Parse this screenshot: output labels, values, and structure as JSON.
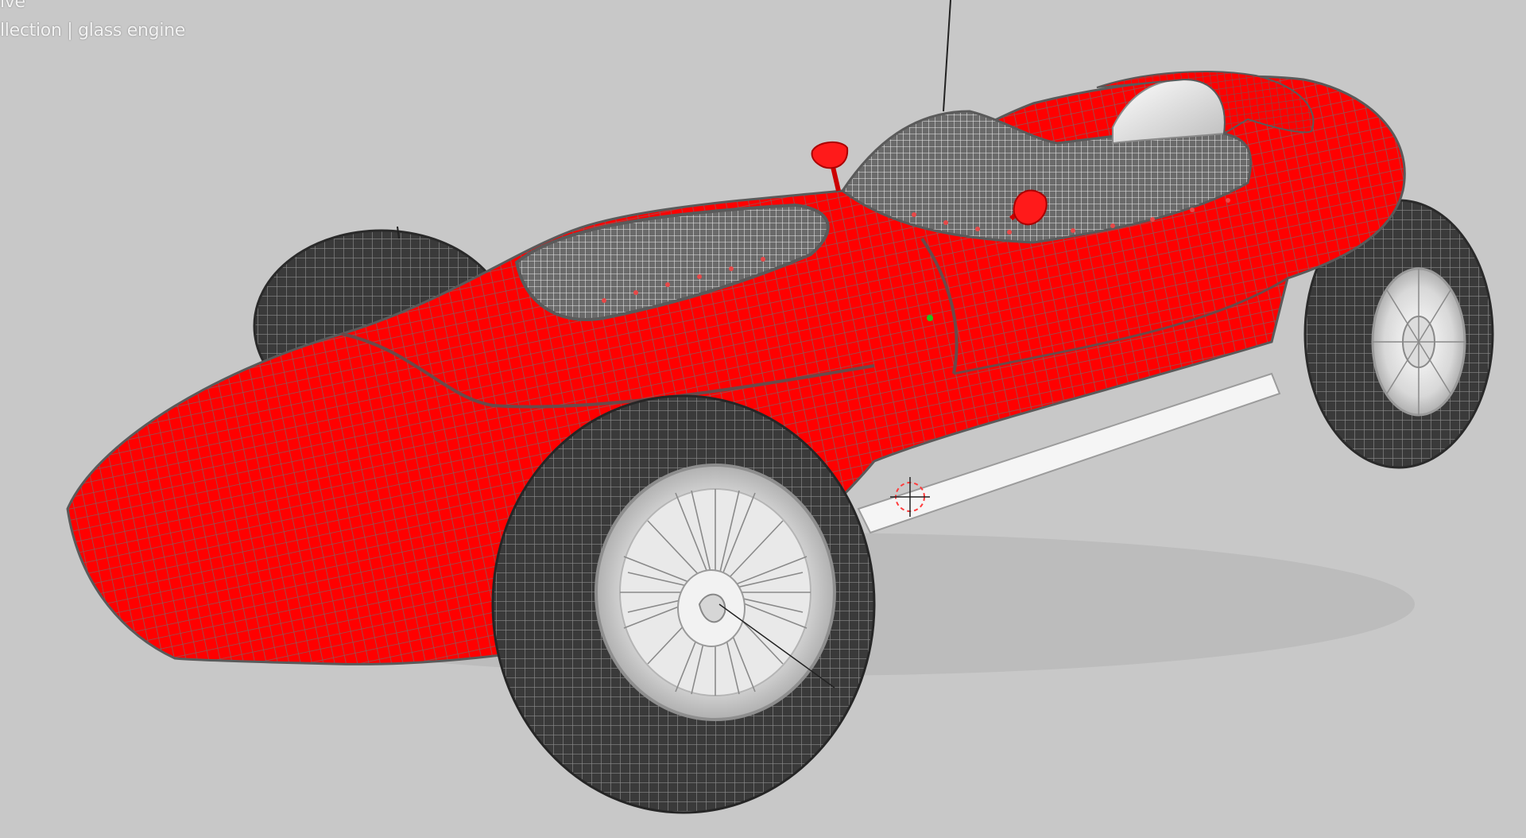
{
  "viewport": {
    "mode_label": "ive",
    "collection_label": "llection | glass engine"
  },
  "colors": {
    "background": "#c8c8c8",
    "body_red": "#ff0000",
    "wire_grey": "#6e6e6e",
    "tire_dark": "#3b3b3b",
    "rim_silver": "#e4e4e4"
  }
}
